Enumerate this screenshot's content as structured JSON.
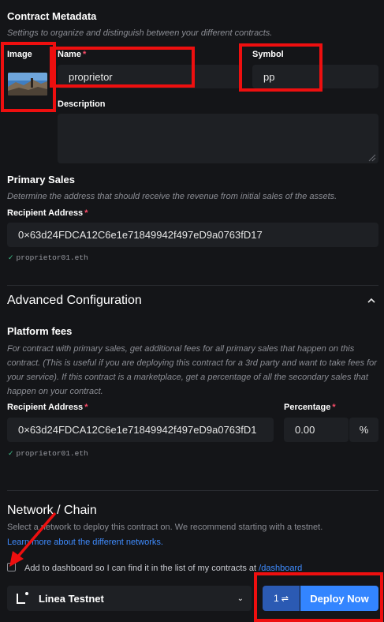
{
  "metadata": {
    "title": "Contract Metadata",
    "subtitle": "Settings to organize and distinguish between your different contracts.",
    "image_label": "Image",
    "name_label": "Name",
    "name_value": "proprietor",
    "symbol_label": "Symbol",
    "symbol_value": "pp",
    "description_label": "Description",
    "description_value": ""
  },
  "primary_sales": {
    "title": "Primary Sales",
    "subtitle": "Determine the address that should receive the revenue from initial sales of the assets.",
    "recipient_label": "Recipient Address",
    "recipient_value": "0×63d24FDCA12C6e1e71849942f497eD9a0763fD17",
    "ens_name": "proprietor01.eth"
  },
  "advanced": {
    "title": "Advanced Configuration",
    "platform_fees_title": "Platform fees",
    "platform_fees_desc": "For contract with primary sales, get additional fees for all primary sales that happen on this contract. (This is useful if you are deploying this contract for a 3rd party and want to take fees for your service). If this contract is a marketplace, get a percentage of all the secondary sales that happen on your contract.",
    "recipient_label": "Recipient Address",
    "recipient_value": "0×63d24FDCA12C6e1e71849942f497eD9a0763fD1",
    "percentage_label": "Percentage",
    "percentage_value": "0.00",
    "percentage_unit": "%",
    "ens_name": "proprietor01.eth"
  },
  "network": {
    "title": "Network / Chain",
    "desc": "Select a network to deploy this contract on. We recommend starting with a testnet.",
    "link_text": "Learn more about the different networks.",
    "checkbox_text": "Add to dashboard so I can find it in the list of my contracts at",
    "checkbox_link": "/dashboard",
    "selected_network": "Linea Testnet",
    "tx_count": "1",
    "deploy_label": "Deploy Now"
  },
  "colors": {
    "background": "#141518",
    "accent": "#3385ff",
    "annotation_red": "#ee0f0f"
  }
}
